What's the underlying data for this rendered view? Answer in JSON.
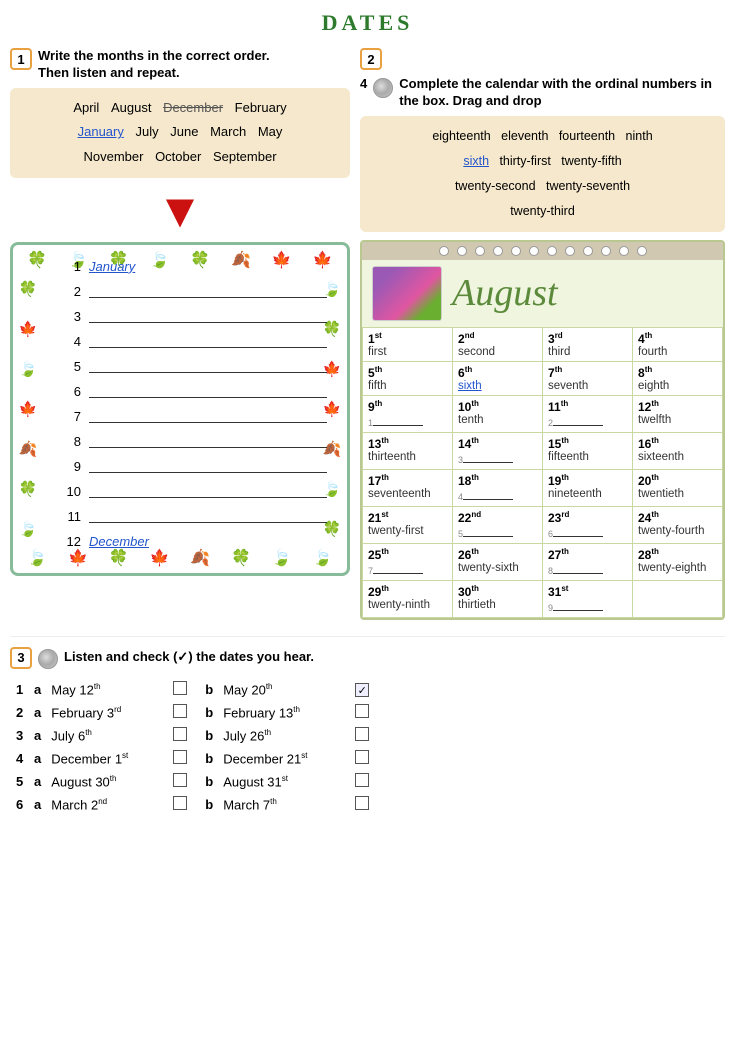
{
  "title": "DATES",
  "section1": {
    "num": "1",
    "instruction": "Write the months in the correct order.\nThen listen and repeat.",
    "months_row1": [
      "April",
      "August",
      "December",
      "February"
    ],
    "months_row2": [
      "January",
      "July",
      "June",
      "March",
      "May"
    ],
    "months_row3": [
      "November",
      "October",
      "September"
    ],
    "december_strikethrough": true,
    "january_underline": true
  },
  "month_list": [
    {
      "num": "1",
      "name": "January",
      "link": true
    },
    {
      "num": "2",
      "name": "",
      "line": true
    },
    {
      "num": "3",
      "name": "",
      "line": true
    },
    {
      "num": "4",
      "name": "",
      "line": true
    },
    {
      "num": "5",
      "name": "",
      "line": true
    },
    {
      "num": "6",
      "name": "",
      "line": true
    },
    {
      "num": "7",
      "name": "",
      "line": true
    },
    {
      "num": "8",
      "name": "",
      "line": true
    },
    {
      "num": "9",
      "name": "",
      "line": true
    },
    {
      "num": "10",
      "name": "",
      "line": true
    },
    {
      "num": "11",
      "name": "",
      "line": true
    },
    {
      "num": "12",
      "name": "December",
      "link": true
    }
  ],
  "section2": {
    "num": "2",
    "num4": "4",
    "instruction": "Complete the calendar with the ordinal numbers in the box.   Drag and drop",
    "word_bank": [
      "eighteenth",
      "eleventh",
      "fourteenth",
      "ninth",
      "sixth",
      "thirty-first",
      "twenty-fifth",
      "twenty-second",
      "twenty-seventh",
      "twenty-third"
    ],
    "sixth_blue": true
  },
  "calendar": {
    "month": "August",
    "spiral_count": 12,
    "cells": [
      {
        "date": "1",
        "sup": "st",
        "ordinal": "first",
        "fill": false
      },
      {
        "date": "2",
        "sup": "nd",
        "ordinal": "second",
        "fill": false
      },
      {
        "date": "3",
        "sup": "rd",
        "ordinal": "third",
        "fill": false
      },
      {
        "date": "4",
        "sup": "th",
        "ordinal": "fourth",
        "fill": false
      },
      {
        "date": "5",
        "sup": "th",
        "ordinal": "fifth",
        "fill": false
      },
      {
        "date": "6",
        "sup": "th",
        "ordinal": "sixth",
        "fill": false,
        "blue": true
      },
      {
        "date": "7",
        "sup": "th",
        "ordinal": "seventh",
        "fill": false
      },
      {
        "date": "8",
        "sup": "th",
        "ordinal": "eighth",
        "fill": false
      },
      {
        "date": "9",
        "sup": "th",
        "ordinal": "",
        "fill": true,
        "fill_num": "1"
      },
      {
        "date": "10",
        "sup": "th",
        "ordinal": "tenth",
        "fill": false
      },
      {
        "date": "11",
        "sup": "th",
        "ordinal": "",
        "fill": true,
        "fill_num": "2"
      },
      {
        "date": "12",
        "sup": "th",
        "ordinal": "twelfth",
        "fill": false
      },
      {
        "date": "13",
        "sup": "th",
        "ordinal": "thirteenth",
        "fill": false
      },
      {
        "date": "14",
        "sup": "th",
        "ordinal": "",
        "fill": true,
        "fill_num": "3"
      },
      {
        "date": "15",
        "sup": "th",
        "ordinal": "fifteenth",
        "fill": false
      },
      {
        "date": "16",
        "sup": "th",
        "ordinal": "sixteenth",
        "fill": false
      },
      {
        "date": "17",
        "sup": "th",
        "ordinal": "seventeenth",
        "fill": false
      },
      {
        "date": "18",
        "sup": "th",
        "ordinal": "",
        "fill": true,
        "fill_num": "4"
      },
      {
        "date": "19",
        "sup": "th",
        "ordinal": "nineteenth",
        "fill": false
      },
      {
        "date": "20",
        "sup": "th",
        "ordinal": "twentieth",
        "fill": false
      },
      {
        "date": "21",
        "sup": "st",
        "ordinal": "twenty-first",
        "fill": false
      },
      {
        "date": "22",
        "sup": "nd",
        "ordinal": "",
        "fill": true,
        "fill_num": "5"
      },
      {
        "date": "23",
        "sup": "rd",
        "ordinal": "",
        "fill": true,
        "fill_num": "6"
      },
      {
        "date": "24",
        "sup": "th",
        "ordinal": "twenty-fourth",
        "fill": false
      },
      {
        "date": "25",
        "sup": "th",
        "ordinal": "",
        "fill": true,
        "fill_num": "7"
      },
      {
        "date": "26",
        "sup": "th",
        "ordinal": "twenty-sixth",
        "fill": false
      },
      {
        "date": "27",
        "sup": "th",
        "ordinal": "",
        "fill": true,
        "fill_num": "8"
      },
      {
        "date": "28",
        "sup": "th",
        "ordinal": "twenty-eighth",
        "fill": false
      },
      {
        "date": "29",
        "sup": "th",
        "ordinal": "twenty-ninth",
        "fill": false
      },
      {
        "date": "30",
        "sup": "th",
        "ordinal": "thirtieth",
        "fill": false
      },
      {
        "date": "31",
        "sup": "st",
        "ordinal": "",
        "fill": true,
        "fill_num": "9"
      },
      {
        "date": "",
        "sup": "",
        "ordinal": "",
        "fill": false,
        "empty": true
      }
    ]
  },
  "section3": {
    "num": "3",
    "instruction": "Listen and check (✓) the dates you hear.",
    "items": [
      {
        "row": "1",
        "a_text": "May 12",
        "a_sup": "th",
        "a_checked": false,
        "b_text": "May 20",
        "b_sup": "th",
        "b_checked": true
      },
      {
        "row": "2",
        "a_text": "February 3",
        "a_sup": "rd",
        "a_checked": false,
        "b_text": "February 13",
        "b_sup": "th",
        "b_checked": false
      },
      {
        "row": "3",
        "a_text": "July 6",
        "a_sup": "th",
        "a_checked": false,
        "b_text": "July 26",
        "b_sup": "th",
        "b_checked": false
      },
      {
        "row": "4",
        "a_text": "December 1",
        "a_sup": "st",
        "a_checked": false,
        "b_text": "December 21",
        "b_sup": "st",
        "b_checked": false
      },
      {
        "row": "5",
        "a_text": "August 30",
        "a_sup": "th",
        "a_checked": false,
        "b_text": "August 31",
        "b_sup": "st",
        "b_checked": false
      },
      {
        "row": "6",
        "a_text": "March 2",
        "a_sup": "nd",
        "a_checked": false,
        "b_text": "March 7",
        "b_sup": "th",
        "b_checked": false
      }
    ]
  }
}
